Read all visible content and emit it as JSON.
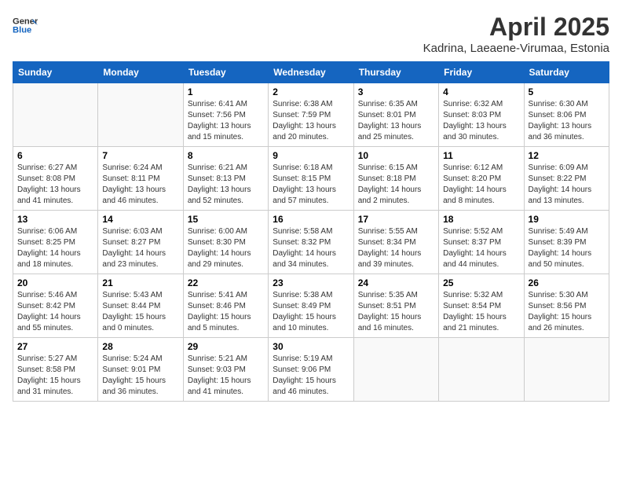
{
  "header": {
    "logo_general": "General",
    "logo_blue": "Blue",
    "month_title": "April 2025",
    "subtitle": "Kadrina, Laeaene-Virumaa, Estonia"
  },
  "days_of_week": [
    "Sunday",
    "Monday",
    "Tuesday",
    "Wednesday",
    "Thursday",
    "Friday",
    "Saturday"
  ],
  "weeks": [
    [
      {
        "day": "",
        "info": ""
      },
      {
        "day": "",
        "info": ""
      },
      {
        "day": "1",
        "info": "Sunrise: 6:41 AM\nSunset: 7:56 PM\nDaylight: 13 hours and 15 minutes."
      },
      {
        "day": "2",
        "info": "Sunrise: 6:38 AM\nSunset: 7:59 PM\nDaylight: 13 hours and 20 minutes."
      },
      {
        "day": "3",
        "info": "Sunrise: 6:35 AM\nSunset: 8:01 PM\nDaylight: 13 hours and 25 minutes."
      },
      {
        "day": "4",
        "info": "Sunrise: 6:32 AM\nSunset: 8:03 PM\nDaylight: 13 hours and 30 minutes."
      },
      {
        "day": "5",
        "info": "Sunrise: 6:30 AM\nSunset: 8:06 PM\nDaylight: 13 hours and 36 minutes."
      }
    ],
    [
      {
        "day": "6",
        "info": "Sunrise: 6:27 AM\nSunset: 8:08 PM\nDaylight: 13 hours and 41 minutes."
      },
      {
        "day": "7",
        "info": "Sunrise: 6:24 AM\nSunset: 8:11 PM\nDaylight: 13 hours and 46 minutes."
      },
      {
        "day": "8",
        "info": "Sunrise: 6:21 AM\nSunset: 8:13 PM\nDaylight: 13 hours and 52 minutes."
      },
      {
        "day": "9",
        "info": "Sunrise: 6:18 AM\nSunset: 8:15 PM\nDaylight: 13 hours and 57 minutes."
      },
      {
        "day": "10",
        "info": "Sunrise: 6:15 AM\nSunset: 8:18 PM\nDaylight: 14 hours and 2 minutes."
      },
      {
        "day": "11",
        "info": "Sunrise: 6:12 AM\nSunset: 8:20 PM\nDaylight: 14 hours and 8 minutes."
      },
      {
        "day": "12",
        "info": "Sunrise: 6:09 AM\nSunset: 8:22 PM\nDaylight: 14 hours and 13 minutes."
      }
    ],
    [
      {
        "day": "13",
        "info": "Sunrise: 6:06 AM\nSunset: 8:25 PM\nDaylight: 14 hours and 18 minutes."
      },
      {
        "day": "14",
        "info": "Sunrise: 6:03 AM\nSunset: 8:27 PM\nDaylight: 14 hours and 23 minutes."
      },
      {
        "day": "15",
        "info": "Sunrise: 6:00 AM\nSunset: 8:30 PM\nDaylight: 14 hours and 29 minutes."
      },
      {
        "day": "16",
        "info": "Sunrise: 5:58 AM\nSunset: 8:32 PM\nDaylight: 14 hours and 34 minutes."
      },
      {
        "day": "17",
        "info": "Sunrise: 5:55 AM\nSunset: 8:34 PM\nDaylight: 14 hours and 39 minutes."
      },
      {
        "day": "18",
        "info": "Sunrise: 5:52 AM\nSunset: 8:37 PM\nDaylight: 14 hours and 44 minutes."
      },
      {
        "day": "19",
        "info": "Sunrise: 5:49 AM\nSunset: 8:39 PM\nDaylight: 14 hours and 50 minutes."
      }
    ],
    [
      {
        "day": "20",
        "info": "Sunrise: 5:46 AM\nSunset: 8:42 PM\nDaylight: 14 hours and 55 minutes."
      },
      {
        "day": "21",
        "info": "Sunrise: 5:43 AM\nSunset: 8:44 PM\nDaylight: 15 hours and 0 minutes."
      },
      {
        "day": "22",
        "info": "Sunrise: 5:41 AM\nSunset: 8:46 PM\nDaylight: 15 hours and 5 minutes."
      },
      {
        "day": "23",
        "info": "Sunrise: 5:38 AM\nSunset: 8:49 PM\nDaylight: 15 hours and 10 minutes."
      },
      {
        "day": "24",
        "info": "Sunrise: 5:35 AM\nSunset: 8:51 PM\nDaylight: 15 hours and 16 minutes."
      },
      {
        "day": "25",
        "info": "Sunrise: 5:32 AM\nSunset: 8:54 PM\nDaylight: 15 hours and 21 minutes."
      },
      {
        "day": "26",
        "info": "Sunrise: 5:30 AM\nSunset: 8:56 PM\nDaylight: 15 hours and 26 minutes."
      }
    ],
    [
      {
        "day": "27",
        "info": "Sunrise: 5:27 AM\nSunset: 8:58 PM\nDaylight: 15 hours and 31 minutes."
      },
      {
        "day": "28",
        "info": "Sunrise: 5:24 AM\nSunset: 9:01 PM\nDaylight: 15 hours and 36 minutes."
      },
      {
        "day": "29",
        "info": "Sunrise: 5:21 AM\nSunset: 9:03 PM\nDaylight: 15 hours and 41 minutes."
      },
      {
        "day": "30",
        "info": "Sunrise: 5:19 AM\nSunset: 9:06 PM\nDaylight: 15 hours and 46 minutes."
      },
      {
        "day": "",
        "info": ""
      },
      {
        "day": "",
        "info": ""
      },
      {
        "day": "",
        "info": ""
      }
    ]
  ]
}
